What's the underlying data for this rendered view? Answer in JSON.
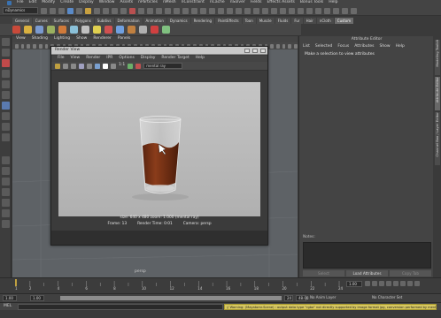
{
  "menubar": {
    "items": [
      "File",
      "Edit",
      "Modify",
      "Create",
      "Display",
      "Window",
      "Assets",
      "nParticles",
      "nMesh",
      "nConstraint",
      "nCache",
      "nSolver",
      "Fields",
      "Effects Assets",
      "Bonus Tools",
      "Help"
    ]
  },
  "statusline": {
    "menu_set": "nDynamics"
  },
  "shelf": {
    "tabs": [
      "General",
      "Curves",
      "Surfaces",
      "Polygons",
      "Subdivs",
      "Deformation",
      "Animation",
      "Dynamics",
      "Rendering",
      "PaintEffects",
      "Toon",
      "Muscle",
      "Fluids",
      "Fur",
      "Hair",
      "nCloth",
      "Custom"
    ],
    "active_tab": "Custom",
    "icon_colors": [
      "#c94a3a",
      "#d8b040",
      "#7a9ad0",
      "#9ab060",
      "#d07a3a",
      "#8ac0d8",
      "#c0c0c0",
      "#e0d050",
      "#d05050",
      "#70a0e0",
      "#c08040",
      "#b0b0b0",
      "#d04040",
      "#80c080"
    ]
  },
  "viewport": {
    "menu": [
      "View",
      "Shading",
      "Lighting",
      "Show",
      "Renderer",
      "Panels"
    ],
    "camera_label": "persp"
  },
  "render_view": {
    "title": "Render View",
    "menu": [
      "File",
      "View",
      "Render",
      "IPR",
      "Options",
      "Display",
      "Render Target",
      "Help"
    ],
    "ratio": "1:1",
    "renderer": "mental ray",
    "info_line1": "size: 640 x 480  zoom: 1.000     (mental ray)",
    "frame": "Frame: 13",
    "render_time": "Render Time: 0:01",
    "camera": "Camera: persp",
    "liquid_color": "#7a3517",
    "background_color": "#b9b9b9"
  },
  "attribute_editor": {
    "title": "Attribute Editor",
    "menu": [
      "List",
      "Selected",
      "Focus",
      "Attributes",
      "Show",
      "Help"
    ],
    "message": "Make a selection to view attributes",
    "notes_label": "Notes:",
    "buttons": [
      "Select",
      "Load Attributes",
      "Copy Tab"
    ],
    "side_tabs": [
      "Modeling Toolkit",
      "Attribute Editor",
      "Channel Box / Layer Editor"
    ]
  },
  "timeline": {
    "tick_labels": [
      "1",
      "2",
      "4",
      "6",
      "8",
      "10",
      "12",
      "14",
      "16",
      "18",
      "20",
      "22",
      "24"
    ],
    "current_time": "1.00",
    "range_start": "1.00",
    "range_inner_start": "1.00",
    "range_inner_end": "24",
    "range_end": "48.00",
    "anim_layer": "No Anim Layer",
    "character_set": "No Character Set"
  },
  "command_line": {
    "label": "MEL",
    "warning": "// Warning: (Mayatomr.Scene) : output data type \"rgba\" not directly supported by image format jpg, conversion performed by mental ray"
  }
}
